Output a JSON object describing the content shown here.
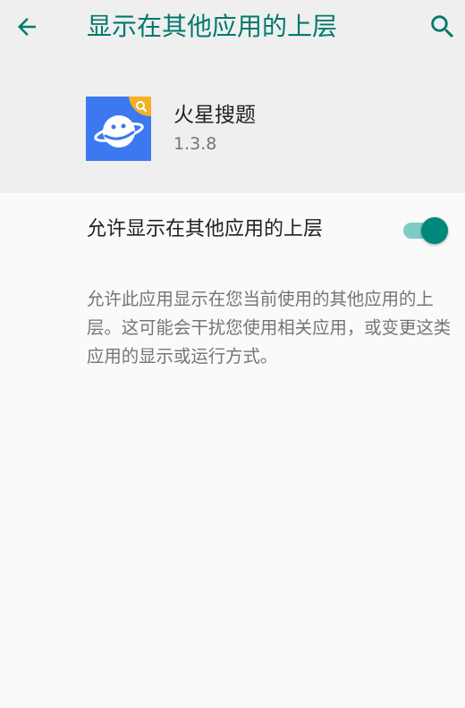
{
  "toolbar": {
    "title": "显示在其他应用的上层",
    "back_icon": "arrow-back-icon",
    "search_icon": "search-icon",
    "accent_color": "#00796b"
  },
  "app": {
    "name": "火星搜题",
    "version": "1.3.8",
    "icon": "planet-app-icon"
  },
  "setting": {
    "label": "允许显示在其他应用的上层",
    "enabled": true,
    "summary": "允许此应用显示在您当前使用的其他应用的上层。这可能会干扰您使用相关应用，或变更这类应用的显示或运行方式。"
  },
  "colors": {
    "header_bg": "#efefef",
    "page_bg": "#fafafa",
    "switch_track": "#80cbc4",
    "switch_thumb": "#00897b"
  }
}
